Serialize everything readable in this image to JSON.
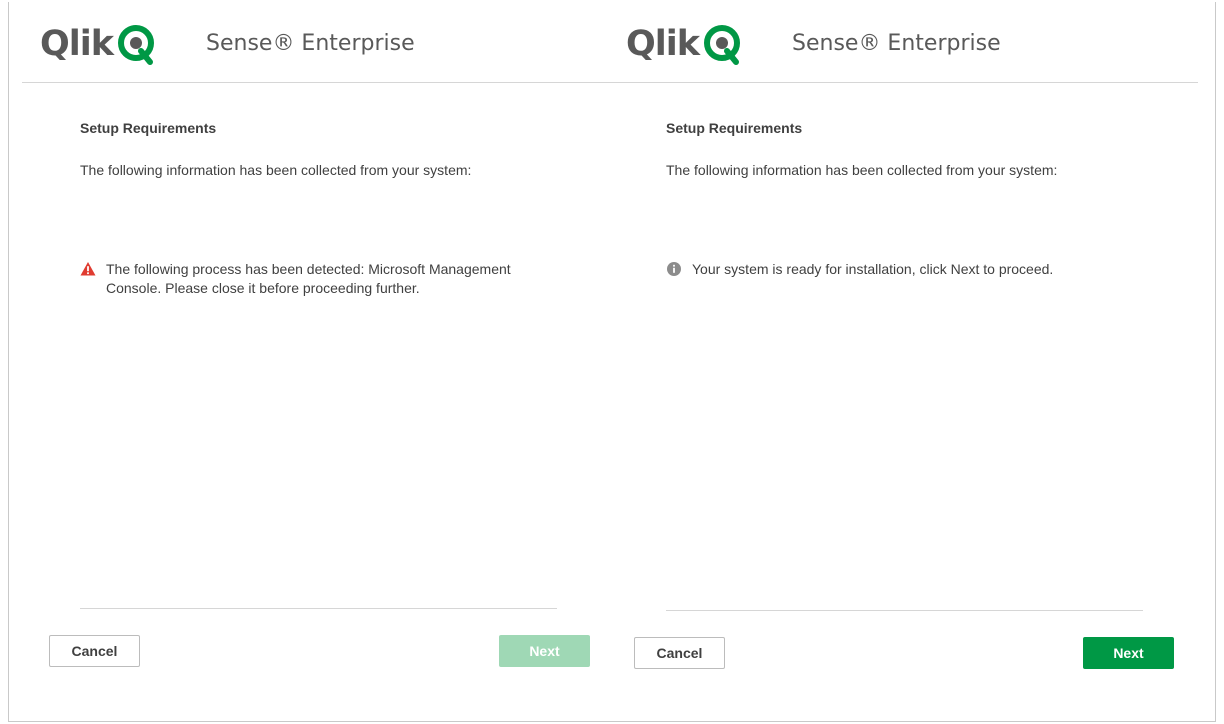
{
  "left_panel": {
    "brand": {
      "logo_text": "Qlik",
      "product_name": "Sense® Enterprise"
    },
    "title": "Setup Requirements",
    "description": "The following information has been collected from your system:",
    "message": {
      "icon": "warning-icon",
      "text": "The following process has been detected: Microsoft Management Console. Please close it before proceeding further."
    },
    "buttons": {
      "cancel_label": "Cancel",
      "next_label": "Next",
      "next_enabled": false
    }
  },
  "right_panel": {
    "brand": {
      "logo_text": "Qlik",
      "product_name": "Sense® Enterprise"
    },
    "title": "Setup Requirements",
    "description": "The following information has been collected from your system:",
    "message": {
      "icon": "info-icon",
      "text": "Your system is ready for installation, click Next to proceed."
    },
    "buttons": {
      "cancel_label": "Cancel",
      "next_label": "Next",
      "next_enabled": true
    }
  },
  "colors": {
    "brand_green": "#009845",
    "disabled_green": "#9fd8b5",
    "warning_red": "#e03c31",
    "info_gray": "#8c8c8c",
    "text": "#404040"
  }
}
